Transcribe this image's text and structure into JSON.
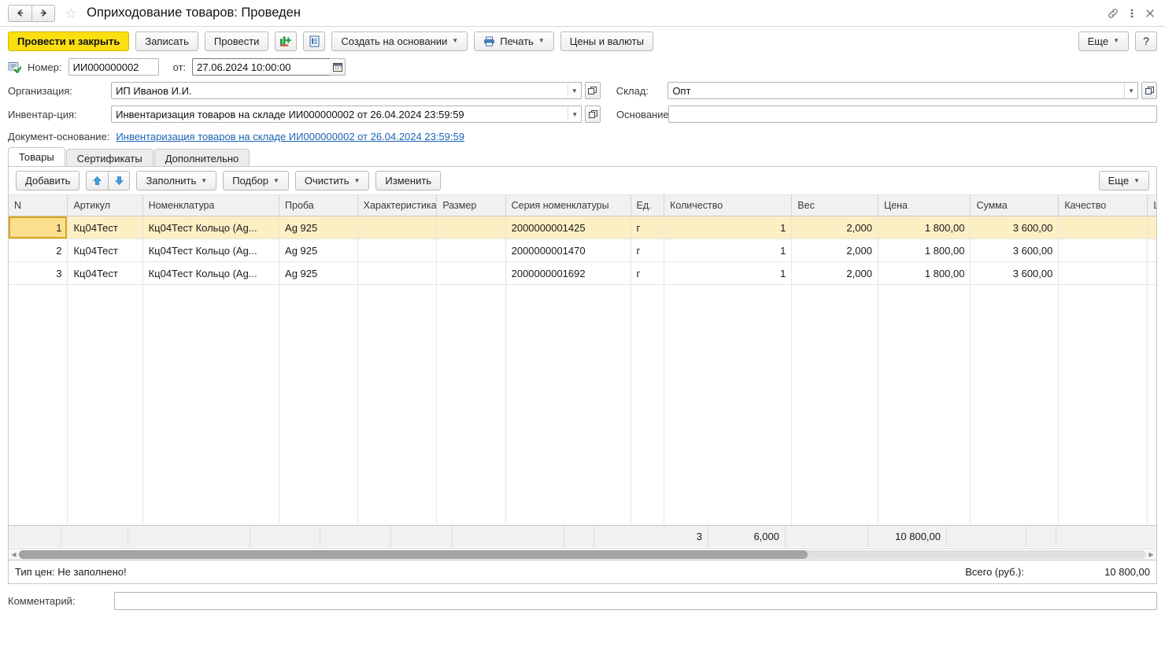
{
  "window": {
    "title": "Оприходование товаров: Проведен",
    "back_icon": "arrow-left-icon",
    "forward_icon": "arrow-right-icon",
    "favorite_icon": "star-icon",
    "link_icon": "link-icon",
    "menu_icon": "kebab-menu-icon",
    "close_icon": "close-icon"
  },
  "commandbar": {
    "post_and_close": "Провести и закрыть",
    "write": "Записать",
    "post": "Провести",
    "report_icon": "chart-add-icon",
    "movements_icon": "document-report-icon",
    "create_based_on": "Создать на основании",
    "print": "Печать",
    "print_icon": "printer-icon",
    "prices_currencies": "Цены и валюты",
    "more": "Еще",
    "help": "?"
  },
  "header": {
    "status_icon": "document-posted-icon",
    "number_label": "Номер:",
    "number_value": "ИИ000000002",
    "date_label": "от:",
    "date_value": "27.06.2024 10:00:00",
    "calendar_icon": "calendar-icon",
    "organization_label": "Организация:",
    "organization_value": "ИП Иванов И.И.",
    "warehouse_label": "Склад:",
    "warehouse_value": "Опт",
    "inventory_label": "Инвентар-ция:",
    "inventory_value": "Инвентаризация товаров на складе ИИ000000002 от 26.04.2024 23:59:59",
    "basis_label": "Основание:",
    "basis_value": "",
    "basis_doc_label": "Документ-основание:",
    "basis_doc_link": "Инвентаризация товаров на складе ИИ000000002 от 26.04.2024 23:59:59"
  },
  "tabs": [
    {
      "label": "Товары",
      "active": true
    },
    {
      "label": "Сертификаты",
      "active": false
    },
    {
      "label": "Дополнительно",
      "active": false
    }
  ],
  "table_toolbar": {
    "add": "Добавить",
    "move_up_icon": "arrow-up-icon",
    "move_down_icon": "arrow-down-icon",
    "fill": "Заполнить",
    "pick": "Подбор",
    "clear": "Очистить",
    "change": "Изменить",
    "more": "Еще"
  },
  "table": {
    "columns": [
      "N",
      "Артикул",
      "Номенклатура",
      "Проба",
      "Характеристика",
      "Размер",
      "Серия номенклатуры",
      "Ед.",
      "Количество",
      "Вес",
      "Цена",
      "Сумма",
      "Качество",
      "ШК"
    ],
    "rows": [
      {
        "n": "1",
        "article": "Кц04Тест",
        "nomenclature": "Кц04Тест Кольцо (Ag...",
        "assay": "Ag 925",
        "characteristic": "",
        "size": "",
        "series": "2000000001425",
        "unit": "г",
        "quantity": "1",
        "weight": "2,000",
        "price": "1 800,00",
        "sum": "3 600,00",
        "quality": "",
        "barcode": "",
        "selected": true
      },
      {
        "n": "2",
        "article": "Кц04Тест",
        "nomenclature": "Кц04Тест Кольцо (Ag...",
        "assay": "Ag 925",
        "characteristic": "",
        "size": "",
        "series": "2000000001470",
        "unit": "г",
        "quantity": "1",
        "weight": "2,000",
        "price": "1 800,00",
        "sum": "3 600,00",
        "quality": "",
        "barcode": "",
        "selected": false
      },
      {
        "n": "3",
        "article": "Кц04Тест",
        "nomenclature": "Кц04Тест Кольцо (Ag...",
        "assay": "Ag 925",
        "characteristic": "",
        "size": "",
        "series": "2000000001692",
        "unit": "г",
        "quantity": "1",
        "weight": "2,000",
        "price": "1 800,00",
        "sum": "3 600,00",
        "quality": "",
        "barcode": "",
        "selected": false
      }
    ],
    "totals": {
      "quantity": "3",
      "weight": "6,000",
      "price": "",
      "sum": "10 800,00"
    }
  },
  "status": {
    "price_type": "Тип цен: Не заполнено!",
    "total_label": "Всего (руб.):",
    "total_value": "10 800,00"
  },
  "comment": {
    "label": "Комментарий:",
    "value": ""
  },
  "colors": {
    "accent_yellow": "#fcdf10",
    "selected_row": "#fcefc4",
    "link_blue": "#1b63b5"
  }
}
